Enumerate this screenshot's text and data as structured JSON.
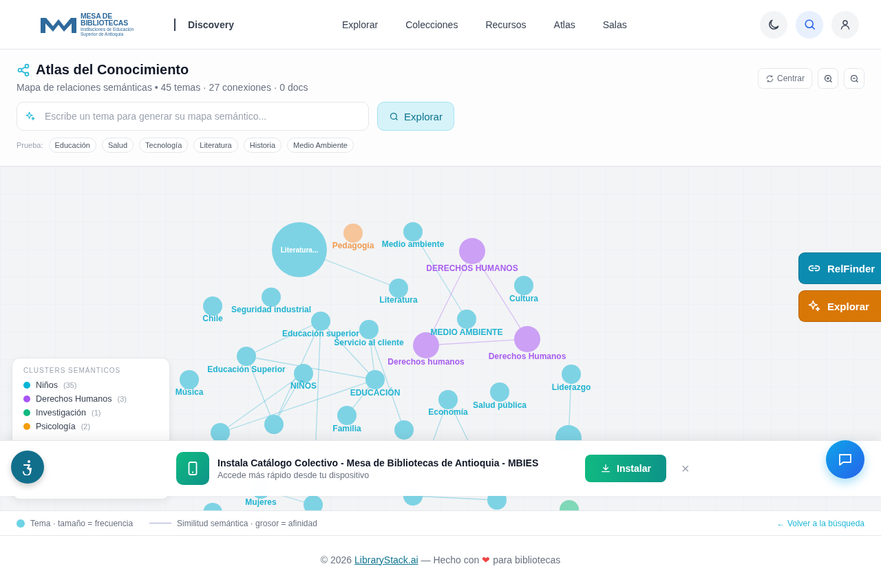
{
  "header": {
    "logo_title": "MESA DE",
    "logo_title_2": "BIBLIOTECAS",
    "logo_subtitle": "Instituciones de Educación Superior de Antioquia",
    "product": "Discovery",
    "nav": [
      {
        "label": "Explorar"
      },
      {
        "label": "Colecciones"
      },
      {
        "label": "Recursos"
      },
      {
        "label": "Atlas"
      },
      {
        "label": "Salas"
      }
    ]
  },
  "page": {
    "title": "Atlas del Conocimiento",
    "subtitle": "Mapa de relaciones semánticas • 45 temas · 27 conexiones · 0 docs",
    "search": {
      "placeholder": "Escribe un tema para generar su mapa semántico..."
    },
    "explore_button": "Explorar",
    "try_label": "Prueba:",
    "suggestions": [
      "Educación",
      "Salud",
      "Tecnología",
      "Literatura",
      "Historia",
      "Medio Ambiente"
    ],
    "center_button": "Centrar"
  },
  "graph": {
    "nodes": [
      {
        "label": "Literatura...",
        "color": "#7dd3e4",
        "kind": "big"
      },
      {
        "label": "Pedagogía",
        "color": "#f6c59a",
        "kind": "small"
      },
      {
        "label": "Medio ambiente",
        "color": "#7dd3e4",
        "kind": "small"
      },
      {
        "label": "DERECHOS HUMANOS",
        "color": "#cba0f5",
        "kind": "medium"
      },
      {
        "label": "Literatura",
        "color": "#7dd3e4",
        "kind": "small"
      },
      {
        "label": "Cultura",
        "color": "#7dd3e4",
        "kind": "small"
      },
      {
        "label": "Chile",
        "color": "#7dd3e4",
        "kind": "small"
      },
      {
        "label": "Seguridad industrial",
        "color": "#7dd3e4",
        "kind": "small"
      },
      {
        "label": "Educación superior",
        "color": "#7dd3e4",
        "kind": "small"
      },
      {
        "label": "Servicio al cliente",
        "color": "#7dd3e4",
        "kind": "small"
      },
      {
        "label": "MEDIO AMBIENTE",
        "color": "#7dd3e4",
        "kind": "small"
      },
      {
        "label": "Derechos humanos",
        "color": "#cba0f5",
        "kind": "medium"
      },
      {
        "label": "Derechos Humanos",
        "color": "#cba0f5",
        "kind": "medium"
      },
      {
        "label": "Educación Superior",
        "color": "#7dd3e4",
        "kind": "small"
      },
      {
        "label": "Música",
        "color": "#7dd3e4",
        "kind": "small"
      },
      {
        "label": "NIÑOS",
        "color": "#7dd3e4",
        "kind": "small"
      },
      {
        "label": "EDUCACIÓN",
        "color": "#7dd3e4",
        "kind": "small"
      },
      {
        "label": "Liderazgo",
        "color": "#7dd3e4",
        "kind": "small"
      },
      {
        "label": "Economía",
        "color": "#7dd3e4",
        "kind": "small"
      },
      {
        "label": "Salud pública",
        "color": "#7dd3e4",
        "kind": "small"
      },
      {
        "label": "Familia",
        "color": "#7dd3e4",
        "kind": "small"
      },
      {
        "color": "#7dd3e4",
        "kind": "small"
      },
      {
        "color": "#7dd3e4",
        "kind": "small"
      },
      {
        "color": "#7dd3e4",
        "kind": "small"
      },
      {
        "color": "#7dd3e4",
        "kind": "medium"
      },
      {
        "label": "Mujeres",
        "color": "#7dd3e4",
        "kind": "small"
      },
      {
        "color": "#7dd3e4",
        "kind": "small"
      },
      {
        "color": "#7dd3e4",
        "kind": "small"
      },
      {
        "color": "#7dd3e4",
        "kind": "small"
      },
      {
        "color": "#7fd8b8",
        "kind": "small"
      },
      {
        "color": "#7dd3e4",
        "kind": "small"
      }
    ],
    "legend_title": "CLUSTERS SEMÁNTICOS",
    "clusters": [
      {
        "name": "Niños",
        "count": "(35)",
        "color": "#06b6d4"
      },
      {
        "name": "Derechos Humanos",
        "count": "(3)",
        "color": "#a855f7"
      },
      {
        "name": "Investigación",
        "count": "(1)",
        "color": "#10b981"
      },
      {
        "name": "Psicología",
        "count": "(2)",
        "color": "#f59e0b"
      }
    ]
  },
  "side_buttons": [
    {
      "label": "RelFinder",
      "kind": "link"
    },
    {
      "label": "Explorar",
      "kind": "sparkle"
    }
  ],
  "install_banner": {
    "title": "Instala Catálogo Colectivo - Mesa de Bibliotecas de Antioquia - MBIES",
    "subtitle": "Accede más rápido desde tu dispositivo",
    "button": "Instalar",
    "close": "×"
  },
  "graph_legend": {
    "node": "Tema · tamaño = frecuencia",
    "edge": "Similitud semántica · grosor = afinidad",
    "back_link": "← Volver a la búsqueda"
  },
  "footer": {
    "before": "© 2026",
    "link": "LibraryStack.ai",
    "middle": "— Hecho con",
    "heart": "❤",
    "after": "para bibliotecas"
  }
}
